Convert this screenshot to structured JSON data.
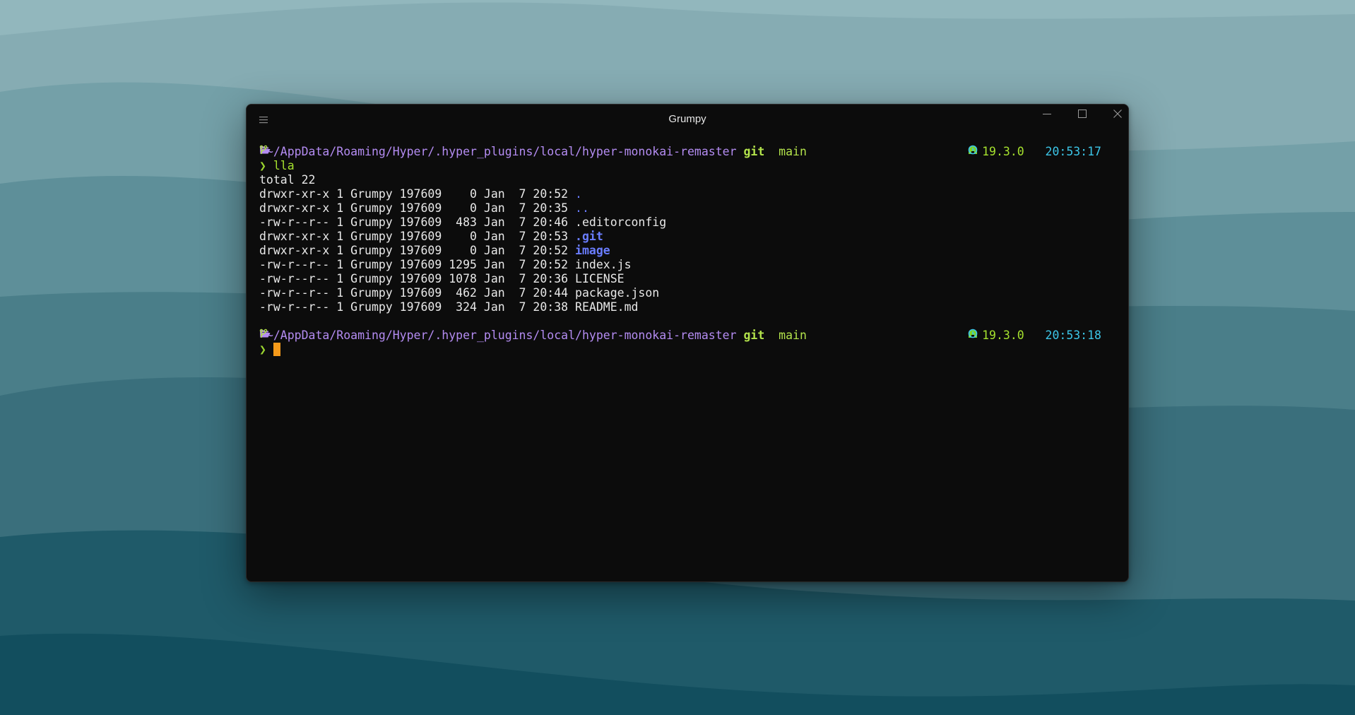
{
  "window": {
    "title": "Grumpy"
  },
  "prompt1": {
    "path": "~/AppData/Roaming/Hyper/.hyper_plugins/local/hyper-monokai-remaster",
    "git_label": "git",
    "branch": "main",
    "node_version": "19.3.0",
    "time": "20:53:17",
    "arrow": "❯",
    "command": "lla"
  },
  "listing": {
    "total": "total 22",
    "rows": [
      {
        "meta": "drwxr-xr-x 1 Grumpy 197609    0 Jan  7 20:52 ",
        "name": ".",
        "kind": "dir"
      },
      {
        "meta": "drwxr-xr-x 1 Grumpy 197609    0 Jan  7 20:35 ",
        "name": "..",
        "kind": "dir"
      },
      {
        "meta": "-rw-r--r-- 1 Grumpy 197609  483 Jan  7 20:46 ",
        "name": ".editorconfig",
        "kind": "file"
      },
      {
        "meta": "drwxr-xr-x 1 Grumpy 197609    0 Jan  7 20:53 ",
        "name": ".git",
        "kind": "dir"
      },
      {
        "meta": "drwxr-xr-x 1 Grumpy 197609    0 Jan  7 20:52 ",
        "name": "image",
        "kind": "dir"
      },
      {
        "meta": "-rw-r--r-- 1 Grumpy 197609 1295 Jan  7 20:52 ",
        "name": "index.js",
        "kind": "file"
      },
      {
        "meta": "-rw-r--r-- 1 Grumpy 197609 1078 Jan  7 20:36 ",
        "name": "LICENSE",
        "kind": "file"
      },
      {
        "meta": "-rw-r--r-- 1 Grumpy 197609  462 Jan  7 20:44 ",
        "name": "package.json",
        "kind": "file"
      },
      {
        "meta": "-rw-r--r-- 1 Grumpy 197609  324 Jan  7 20:38 ",
        "name": "README.md",
        "kind": "file"
      }
    ]
  },
  "prompt2": {
    "path": "~/AppData/Roaming/Hyper/.hyper_plugins/local/hyper-monokai-remaster",
    "git_label": "git",
    "branch": "main",
    "node_version": "19.3.0",
    "time": "20:53:18",
    "arrow": "❯"
  },
  "icons": {
    "folder": "folder-open-icon",
    "branch": "git-branch-icon",
    "node": "node-icon",
    "clock": "clock-icon",
    "menu": "hamburger-menu-icon",
    "minimize": "minimize-icon",
    "maximize": "maximize-icon",
    "close": "close-icon"
  },
  "colors": {
    "path": "#b48cf2",
    "git": "#b3e34b",
    "directory": "#6a7dff",
    "time": "#3cc6e8",
    "cursor": "#f59a1a",
    "terminal_bg": "#0c0c0c"
  }
}
